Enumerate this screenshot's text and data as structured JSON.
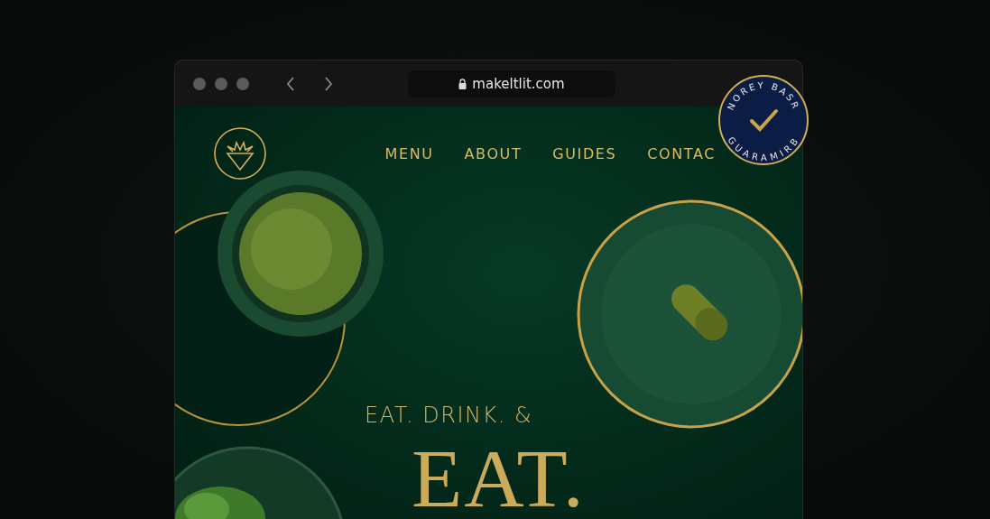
{
  "browser": {
    "url": "makeltlit.com"
  },
  "nav": {
    "links": [
      "MENU",
      "ABOUT",
      "GUIDES",
      "CONTAC"
    ]
  },
  "badge": {
    "top_text": "NOREY BASR",
    "bottom_text": "GUARAMIRB"
  },
  "hero": {
    "kicker": "EAT. DRINK. &",
    "headline": "EAT."
  }
}
